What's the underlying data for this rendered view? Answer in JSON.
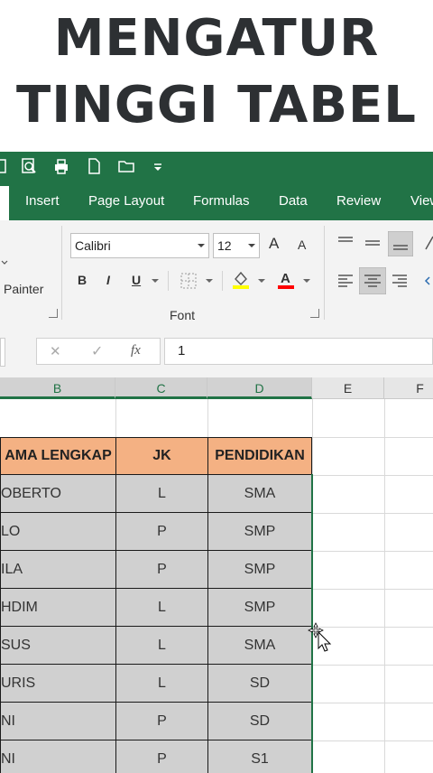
{
  "title": {
    "line1": "MENGATUR",
    "line2": "TINGGI TABEL"
  },
  "qat_icons": [
    "print-preview-icon",
    "quick-print-icon",
    "new-document-icon",
    "open-folder-icon",
    "customize-qat-icon"
  ],
  "tabs": [
    "Insert",
    "Page Layout",
    "Formulas",
    "Data",
    "Review",
    "View"
  ],
  "ribbon": {
    "clipboard": {
      "painter_label": "Painter"
    },
    "font": {
      "font_name": "Calibri",
      "font_size": "12",
      "bold": "B",
      "italic": "I",
      "underline": "U",
      "grow_label": "A",
      "shrink_label": "A",
      "group_label": "Font",
      "fill_color": "#ffff00",
      "font_color": "#ff0000"
    }
  },
  "formula_bar": {
    "cancel": "✕",
    "enter": "✓",
    "fx": "fx",
    "value": "1"
  },
  "columns": [
    "B",
    "C",
    "D",
    "E",
    "F"
  ],
  "table": {
    "headers": [
      "AMA LENGKAP",
      "JK",
      "PENDIDIKAN"
    ],
    "rows": [
      [
        "OBERTO",
        "L",
        "SMA"
      ],
      [
        "LO",
        "P",
        "SMP"
      ],
      [
        "ILA",
        "P",
        "SMP"
      ],
      [
        "HDIM",
        "L",
        "SMP"
      ],
      [
        "SUS",
        "L",
        "SMA"
      ],
      [
        "URIS",
        "L",
        "SD"
      ],
      [
        "NI",
        "P",
        "SD"
      ],
      [
        "NI",
        "P",
        "S1"
      ]
    ],
    "header_color": "#f4b183",
    "selection_color": "#d0d0d0"
  },
  "accent_color": "#217346"
}
